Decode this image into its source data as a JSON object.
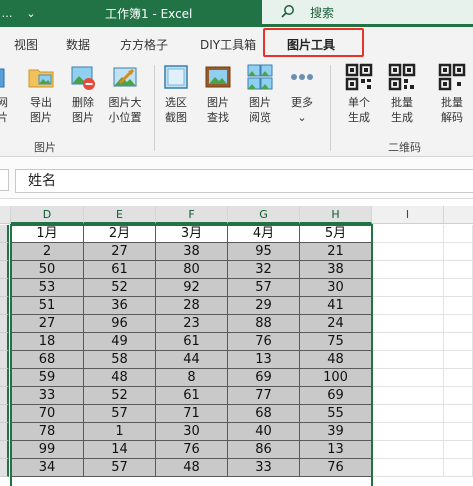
{
  "title_bar": {
    "title": "工作簿1  -  Excel",
    "search_label": "搜索",
    "accent": "#217346"
  },
  "tabs": [
    {
      "label": "视图"
    },
    {
      "label": "数据"
    },
    {
      "label": "方方格子"
    },
    {
      "label": "DIY工具箱"
    },
    {
      "label": "图片工具"
    }
  ],
  "ribbon": {
    "partial_labels": [
      "网",
      "片"
    ],
    "buttons": [
      {
        "line1": "导出",
        "line2": "图片",
        "icon": "folder-image-icon"
      },
      {
        "line1": "删除",
        "line2": "图片",
        "icon": "delete-image-icon"
      },
      {
        "line1": "图片大",
        "line2": "小位置",
        "icon": "image-resize-icon"
      },
      {
        "line1": "选区",
        "line2": "截图",
        "icon": "screenshot-icon"
      },
      {
        "line1": "图片",
        "line2": "查找",
        "icon": "image-find-icon"
      },
      {
        "line1": "图片",
        "line2": "阅览",
        "icon": "image-browse-icon"
      },
      {
        "line1": "更多",
        "line2": "⌄",
        "icon": "more-icon"
      },
      {
        "line1": "单个",
        "line2": "生成",
        "icon": "qr-single-icon"
      },
      {
        "line1": "批量",
        "line2": "生成",
        "icon": "qr-batch-icon"
      },
      {
        "line1": "批量",
        "line2": "解码",
        "icon": "qr-decode-icon"
      }
    ],
    "groups": [
      {
        "label": "图片"
      },
      {
        "label": "二维码"
      }
    ]
  },
  "formula_bar": {
    "value": "姓名"
  },
  "sheet": {
    "columns": [
      "D",
      "E",
      "F",
      "G",
      "H",
      "I"
    ],
    "header_row": [
      "1月",
      "2月",
      "3月",
      "4月",
      "5月"
    ],
    "rows": [
      [
        "2",
        "27",
        "38",
        "95",
        "21"
      ],
      [
        "50",
        "61",
        "80",
        "32",
        "38"
      ],
      [
        "53",
        "52",
        "92",
        "57",
        "30"
      ],
      [
        "51",
        "36",
        "28",
        "29",
        "41"
      ],
      [
        "27",
        "96",
        "23",
        "88",
        "24"
      ],
      [
        "18",
        "49",
        "61",
        "76",
        "75"
      ],
      [
        "68",
        "58",
        "44",
        "13",
        "48"
      ],
      [
        "59",
        "48",
        "8",
        "69",
        "100"
      ],
      [
        "33",
        "52",
        "61",
        "77",
        "69"
      ],
      [
        "70",
        "57",
        "71",
        "68",
        "55"
      ],
      [
        "78",
        "1",
        "30",
        "40",
        "39"
      ],
      [
        "99",
        "14",
        "76",
        "86",
        "13"
      ],
      [
        "34",
        "57",
        "48",
        "33",
        "76"
      ]
    ]
  }
}
